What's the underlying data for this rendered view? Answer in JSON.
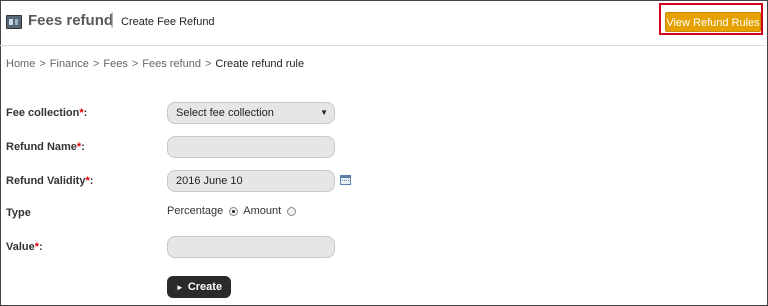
{
  "header": {
    "module_title": "Fees refund",
    "separator": "|",
    "page_title": "Create Fee Refund",
    "view_rules_label": "View Refund Rules"
  },
  "breadcrumb": {
    "items": [
      "Home",
      "Finance",
      "Fees",
      "Fees refund"
    ],
    "current": "Create refund rule",
    "separator": ">"
  },
  "form": {
    "fee_collection": {
      "label": "Fee collection",
      "required_mark": "*",
      "suffix": ":",
      "value": "Select fee collection"
    },
    "refund_name": {
      "label": "Refund Name",
      "required_mark": "*",
      "suffix": ":",
      "value": ""
    },
    "refund_validity": {
      "label": "Refund Validity",
      "required_mark": "*",
      "suffix": ":",
      "value": "2016 June 10"
    },
    "type": {
      "label": "Type",
      "options": [
        "Percentage",
        "Amount"
      ],
      "selected": "Percentage"
    },
    "value": {
      "label": "Value",
      "required_mark": "*",
      "suffix": ":",
      "value": ""
    },
    "create_label": "Create"
  },
  "colors": {
    "accent_button": "#e6a100",
    "highlight_border": "#d0021b",
    "required": "#e00000",
    "create_button": "#2b2b2b"
  },
  "icons": {
    "module": "fees-module-icon",
    "calendar": "calendar-icon",
    "dropdown": "chevron-down-icon",
    "create": "play-icon"
  }
}
